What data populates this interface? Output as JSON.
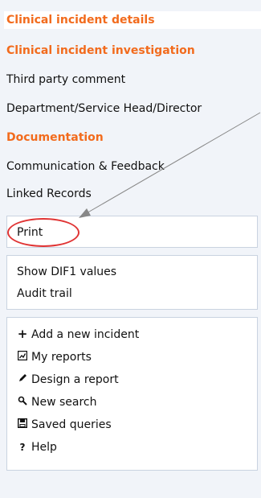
{
  "nav": {
    "items": [
      {
        "label": "Clinical incident details",
        "style": "orange-active"
      },
      {
        "label": "Clinical incident investigation",
        "style": "orange"
      },
      {
        "label": "Third party comment",
        "style": "plain"
      },
      {
        "label": "Department/Service Head/Director",
        "style": "plain"
      },
      {
        "label": "Documentation",
        "style": "orange"
      },
      {
        "label": "Communication & Feedback",
        "style": "plain"
      },
      {
        "label": "Linked Records",
        "style": "plain"
      }
    ]
  },
  "print_panel": {
    "label": "Print"
  },
  "view_panel": {
    "items": [
      "Show DIF1 values",
      "Audit trail"
    ]
  },
  "actions": {
    "items": [
      {
        "label": "Add a new incident",
        "icon": "plus-icon"
      },
      {
        "label": "My reports",
        "icon": "reports-icon"
      },
      {
        "label": "Design a report",
        "icon": "pencil-icon"
      },
      {
        "label": "New search",
        "icon": "search-icon"
      },
      {
        "label": "Saved queries",
        "icon": "save-icon"
      },
      {
        "label": "Help",
        "icon": "help-icon"
      }
    ]
  },
  "colors": {
    "accent": "#f26b1d",
    "annotation": "#e03434",
    "panel_border": "#c9d3e0",
    "background": "#f1f4f9"
  }
}
